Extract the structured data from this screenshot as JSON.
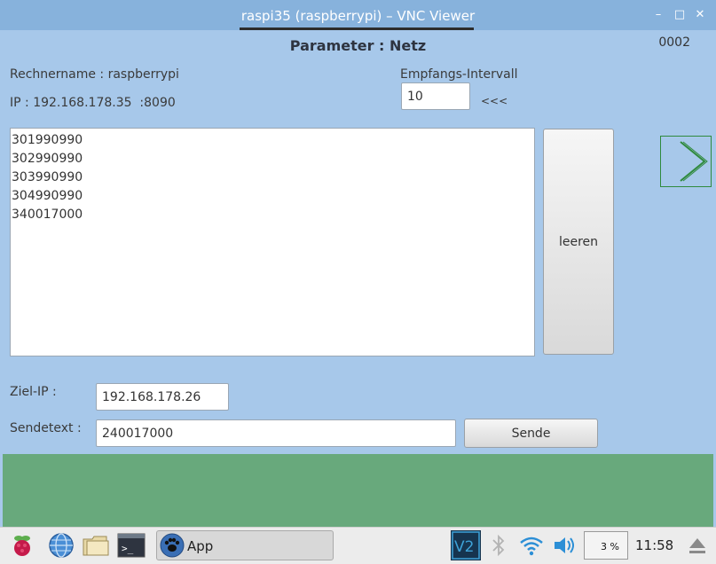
{
  "window": {
    "title": "raspi35 (raspberrypi) – VNC Viewer"
  },
  "page": {
    "heading": "Parameter : Netz",
    "counter": "0002",
    "computer_label": "Rechnername : raspberrypi",
    "ip_label": "IP : 192.168.178.35  :8090",
    "interval_label": "Empfangs-Intervall",
    "interval_value": "10",
    "interval_hint": "<<<",
    "received_lines": [
      "301990990",
      "302990990",
      "303990990",
      "304990990",
      "340017000"
    ],
    "clear_button": "leeren",
    "target_ip_label": "Ziel-IP :",
    "target_ip_value": "192.168.178.26",
    "send_text_label": "Sendetext :",
    "send_text_value": "240017000",
    "send_button": "Sende"
  },
  "taskbar": {
    "app_label": "App",
    "cpu": "3 %",
    "clock": "11:58"
  },
  "colors": {
    "titlebar": "#87b2dc",
    "background": "#a7c8ea",
    "panel_green": "#68a97c",
    "next_outline": "#2f8a3d"
  }
}
